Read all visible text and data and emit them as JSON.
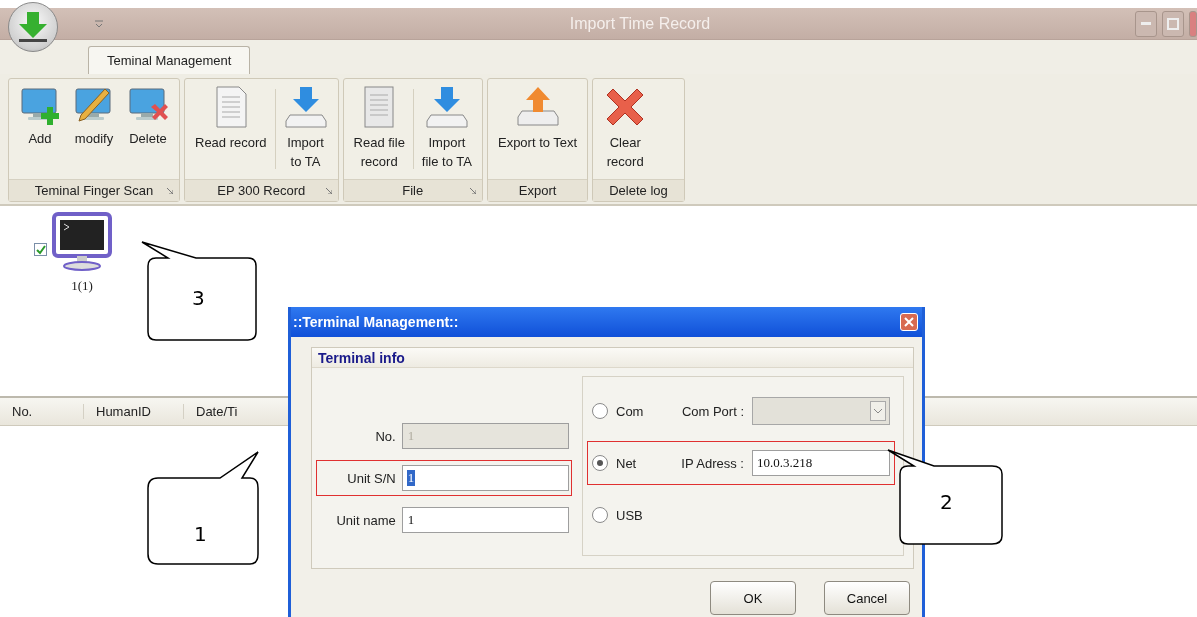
{
  "window": {
    "title": "Import Time Record"
  },
  "tabs": [
    {
      "label": "Teminal Management",
      "selected": true
    }
  ],
  "ribbon": {
    "groups": [
      {
        "label": "Teminal Finger Scan",
        "launcher": true,
        "buttons": [
          {
            "kind": "add",
            "label": "Add"
          },
          {
            "kind": "modify",
            "label": "modify"
          },
          {
            "kind": "delete",
            "label": "Delete"
          }
        ]
      },
      {
        "label": "EP 300 Record",
        "launcher": true,
        "buttons": [
          {
            "kind": "document",
            "label": "Read record"
          },
          {
            "kind": "import",
            "label": "Import\nto TA"
          }
        ]
      },
      {
        "label": "File",
        "launcher": true,
        "buttons": [
          {
            "kind": "book",
            "label": "Read file\nrecord"
          },
          {
            "kind": "import",
            "label": "Import\nfile to TA"
          }
        ]
      },
      {
        "label": "Export",
        "launcher": false,
        "buttons": [
          {
            "kind": "export",
            "label": "Export to Text"
          }
        ]
      },
      {
        "label": "Delete log",
        "launcher": false,
        "buttons": [
          {
            "kind": "clear",
            "label": "Clear\nrecord"
          }
        ]
      }
    ]
  },
  "devices": [
    {
      "label": "1(1)",
      "checked": true
    }
  ],
  "table": {
    "columns": [
      "No.",
      "HumanID",
      "Date/Ti"
    ]
  },
  "dialog": {
    "title": "::Terminal Management::",
    "section": "Terminal info",
    "fields": [
      {
        "label": "No.",
        "value": "1",
        "disabled": true,
        "highlighted": false,
        "annotated": false
      },
      {
        "label": "Unit S/N",
        "value": "1",
        "disabled": false,
        "highlighted": true,
        "annotated": true
      },
      {
        "label": "Unit name",
        "value": "1",
        "disabled": false,
        "highlighted": false,
        "annotated": false
      }
    ],
    "connections": [
      {
        "label": "Com",
        "selected": false,
        "kind": "dropdown",
        "field_label": "Com Port :",
        "disabled": true,
        "annotated": false
      },
      {
        "label": "Net",
        "selected": true,
        "kind": "text",
        "field_label": "IP Adress :",
        "value": "10.0.3.218",
        "annotated": true
      },
      {
        "label": "USB",
        "selected": false,
        "kind": "none",
        "annotated": false
      }
    ],
    "buttons": [
      "OK",
      "Cancel"
    ]
  },
  "callouts": [
    {
      "label": "3"
    },
    {
      "label": "1"
    },
    {
      "label": "2"
    }
  ]
}
